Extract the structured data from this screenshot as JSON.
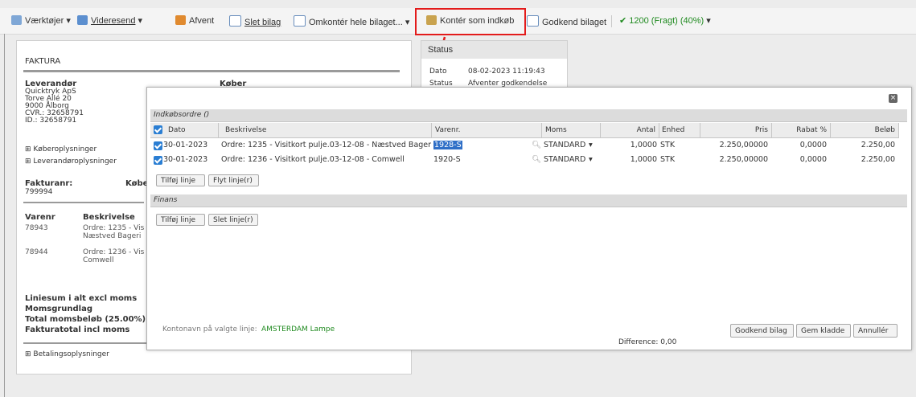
{
  "toolbar": {
    "tools": "Værktøjer",
    "forward": "Videresend",
    "postpone": "Afvent",
    "delete": "Slet bilag",
    "reassign": "Omkontér hele bilaget...",
    "assign_purchase": "Kontér som indkøb",
    "approve": "Godkend bilaget",
    "freight": "1200 (Fragt) (40%)"
  },
  "invoice": {
    "title": "FAKTURA",
    "supplier_label": "Leverandør",
    "buyer_label": "Køber",
    "supplier_lines": [
      "Quicktryk ApS",
      "Torve Allé 20",
      "9000 Ålborg",
      "CVR.: 32658791",
      "ID.: 32658791"
    ],
    "buyer_info": "Køberoplysninger",
    "supplier_info": "Leverandøroplysninger",
    "invoice_no_label": "Fakturanr:",
    "invoice_no": "799994",
    "buyer_short": "Købe",
    "col_itemno": "Varenr",
    "col_desc": "Beskrivelse",
    "rows": [
      {
        "no": "78943",
        "desc1": "Ordre: 1235 - Vis",
        "desc2": "Næstved Bageri"
      },
      {
        "no": "78944",
        "desc1": "Ordre: 1236 - Vis",
        "desc2": "Comwell"
      }
    ],
    "totals": [
      "Liniesum i alt excl moms",
      "Momsgrundlag",
      "Total momsbeløb (25.00%)",
      "Fakturatotal incl moms"
    ],
    "payment_info": "Betalingsoplysninger"
  },
  "status": {
    "title": "Status",
    "date_label": "Dato",
    "date_value": "08-02-2023 11:19:43",
    "status_label": "Status",
    "status_value": "Afventer godkendelse"
  },
  "modal": {
    "purchase_section": "Indkøbsordre ()",
    "columns": [
      "Dato",
      "Beskrivelse",
      "Varenr.",
      "Moms",
      "Antal",
      "Enhed",
      "Pris",
      "Rabat %",
      "Beløb"
    ],
    "rows": [
      {
        "date": "30-01-2023",
        "desc": "Ordre: 1235 - Visitkort pulje.03-12-08 - Næstved Bager",
        "itemno": "1928-S",
        "vat": "STANDARD",
        "qty": "1,0000",
        "unit": "STK",
        "price": "2.250,00000",
        "discount": "0,0000",
        "amount": "2.250,00"
      },
      {
        "date": "30-01-2023",
        "desc": "Ordre: 1236 - Visitkort pulje.03-12-08 - Comwell",
        "itemno": "1920-S",
        "vat": "STANDARD",
        "qty": "1,0000",
        "unit": "STK",
        "price": "2.250,00000",
        "discount": "0,0000",
        "amount": "2.250,00"
      }
    ],
    "add_line": "Tilføj linje",
    "move_lines": "Flyt linje(r)",
    "finance_section": "Finans",
    "add_line2": "Tilføj linje",
    "delete_lines": "Slet linje(r)",
    "account_label": "Kontonavn på valgte linje:",
    "account_value": "AMSTERDAM Lampe",
    "difference": "Difference: 0,00",
    "approve_btn": "Godkend bilag",
    "save_draft_btn": "Gem kladde",
    "cancel_btn": "Annullér"
  },
  "colors": {
    "accent": "#2a7ed3",
    "highlight": "#e31b1b",
    "green": "#1f8a1f"
  }
}
